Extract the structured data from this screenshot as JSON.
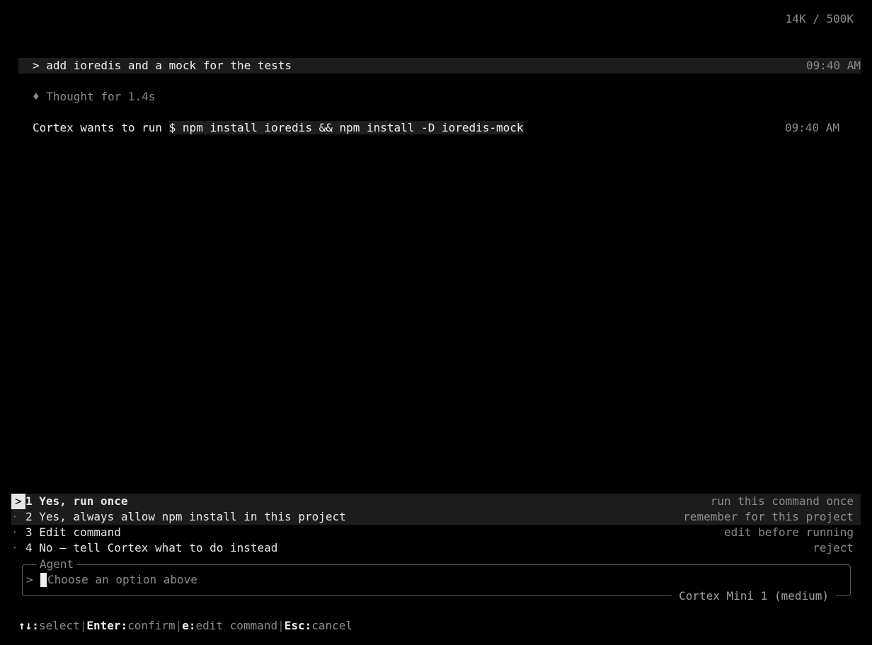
{
  "header": {
    "token_usage": "14K / 500K"
  },
  "conversation": {
    "user_prompt": "> add ioredis and a mock for the tests",
    "user_time": "09:40 AM",
    "thought": "♦ Thought for 1.4s",
    "request_prefix": "Cortex wants to run ",
    "request_command": "$ npm install ioredis && npm install -D ioredis-mock",
    "request_time": "09:40 AM"
  },
  "options": [
    {
      "marker": ">",
      "label": "1 Yes, run once",
      "hint": "run this command once"
    },
    {
      "marker": "·",
      "label": "2 Yes, always allow npm install in this project",
      "hint": "remember for this project"
    },
    {
      "marker": "·",
      "label": "3 Edit command",
      "hint": "edit before running"
    },
    {
      "marker": "·",
      "label": "4 No — tell Cortex what to do instead",
      "hint": "reject"
    }
  ],
  "agent": {
    "title": "Agent",
    "prompt_symbol": ">",
    "placeholder": "Choose an option above",
    "model": "Cortex Mini 1 (medium)"
  },
  "footer": {
    "k1": "↑↓:",
    "d1": "select",
    "sep": "|",
    "k2": "Enter:",
    "d2": "confirm",
    "k3": "e:",
    "d3": "edit command",
    "k4": "Esc:",
    "d4": "cancel"
  },
  "colors": {
    "background": "#000000",
    "text": "#e6e6e6",
    "dim": "#8c8c8c",
    "selected_row": "#1c1c1c"
  }
}
